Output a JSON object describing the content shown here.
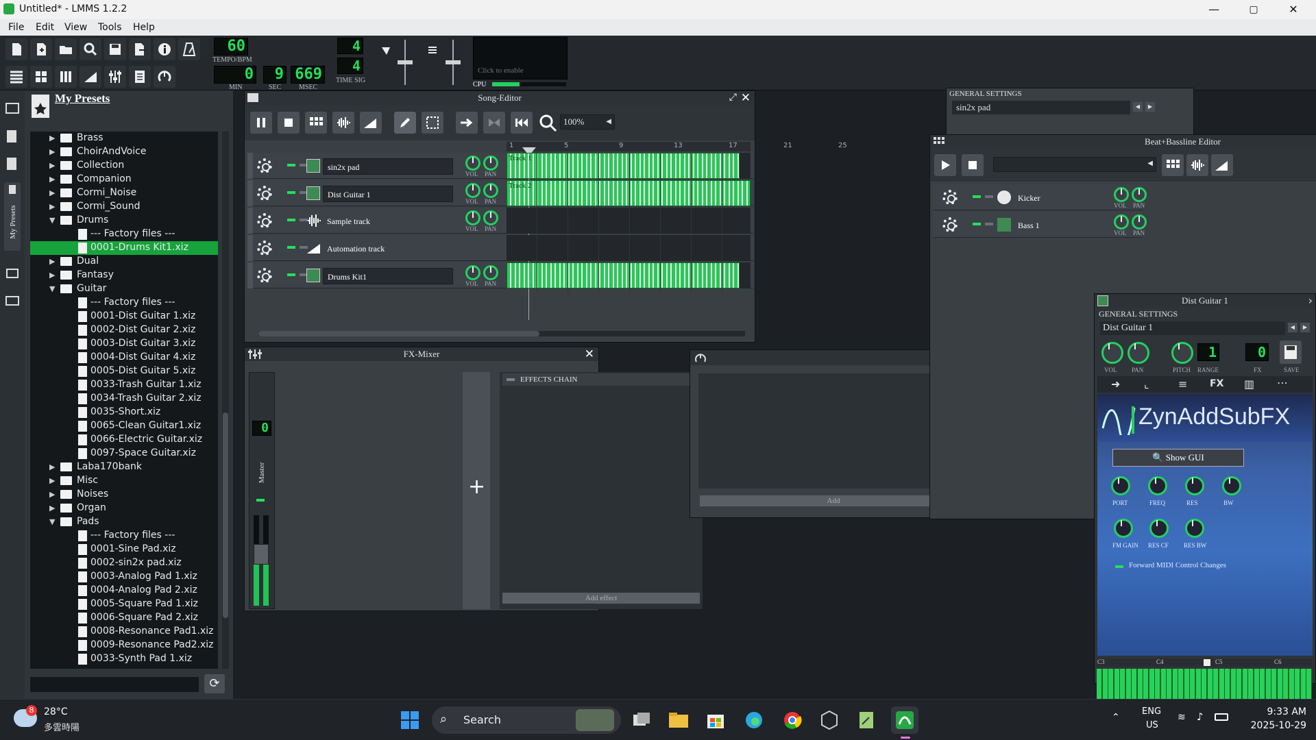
{
  "window": {
    "title": "Untitled* - LMMS 1.2.2",
    "min": "—",
    "max": "▢",
    "close": "✕"
  },
  "menu": [
    "File",
    "Edit",
    "View",
    "Tools",
    "Help"
  ],
  "toolbar": {
    "tempo": "60",
    "tempo_label": "TEMPO/BPM",
    "min": "0",
    "sec": "9",
    "msec": "669",
    "min_label": "MIN",
    "sec_label": "SEC",
    "msec_label": "MSEC",
    "ts_num": "4",
    "ts_den": "4",
    "ts_label": "TIME SIG",
    "cpu_label": "CPU",
    "cpu_hint": "Click to enable"
  },
  "presets": {
    "title": "My Presets",
    "side_tab": "My Presets",
    "items": [
      {
        "label": "Brass",
        "type": "folder",
        "level": 1,
        "open": false
      },
      {
        "label": "ChoirAndVoice",
        "type": "folder",
        "level": 1,
        "open": false
      },
      {
        "label": "Collection",
        "type": "folder",
        "level": 1,
        "open": false
      },
      {
        "label": "Companion",
        "type": "folder",
        "level": 1,
        "open": false
      },
      {
        "label": "Cormi_Noise",
        "type": "folder",
        "level": 1,
        "open": false
      },
      {
        "label": "Cormi_Sound",
        "type": "folder",
        "level": 1,
        "open": false
      },
      {
        "label": "Drums",
        "type": "folder",
        "level": 1,
        "open": true
      },
      {
        "label": "--- Factory files ---",
        "type": "file",
        "level": 2
      },
      {
        "label": "0001-Drums Kit1.xiz",
        "type": "file",
        "level": 2,
        "selected": true
      },
      {
        "label": "Dual",
        "type": "folder",
        "level": 1,
        "open": false
      },
      {
        "label": "Fantasy",
        "type": "folder",
        "level": 1,
        "open": false
      },
      {
        "label": "Guitar",
        "type": "folder",
        "level": 1,
        "open": true
      },
      {
        "label": "--- Factory files ---",
        "type": "file",
        "level": 2
      },
      {
        "label": "0001-Dist Guitar 1.xiz",
        "type": "file",
        "level": 2
      },
      {
        "label": "0002-Dist Guitar 2.xiz",
        "type": "file",
        "level": 2
      },
      {
        "label": "0003-Dist Guitar 3.xiz",
        "type": "file",
        "level": 2
      },
      {
        "label": "0004-Dist Guitar 4.xiz",
        "type": "file",
        "level": 2
      },
      {
        "label": "0005-Dist Guitar 5.xiz",
        "type": "file",
        "level": 2
      },
      {
        "label": "0033-Trash Guitar 1.xiz",
        "type": "file",
        "level": 2
      },
      {
        "label": "0034-Trash Guitar 2.xiz",
        "type": "file",
        "level": 2
      },
      {
        "label": "0035-Short.xiz",
        "type": "file",
        "level": 2
      },
      {
        "label": "0065-Clean Guitar1.xiz",
        "type": "file",
        "level": 2
      },
      {
        "label": "0066-Electric Guitar.xiz",
        "type": "file",
        "level": 2
      },
      {
        "label": "0097-Space Guitar.xiz",
        "type": "file",
        "level": 2
      },
      {
        "label": "Laba170bank",
        "type": "folder",
        "level": 1,
        "open": false
      },
      {
        "label": "Misc",
        "type": "folder",
        "level": 1,
        "open": false
      },
      {
        "label": "Noises",
        "type": "folder",
        "level": 1,
        "open": false
      },
      {
        "label": "Organ",
        "type": "folder",
        "level": 1,
        "open": false
      },
      {
        "label": "Pads",
        "type": "folder",
        "level": 1,
        "open": true
      },
      {
        "label": "--- Factory files ---",
        "type": "file",
        "level": 2
      },
      {
        "label": "0001-Sine Pad.xiz",
        "type": "file",
        "level": 2
      },
      {
        "label": "0002-sin2x  pad.xiz",
        "type": "file",
        "level": 2
      },
      {
        "label": "0003-Analog Pad 1.xiz",
        "type": "file",
        "level": 2
      },
      {
        "label": "0004-Analog Pad 2.xiz",
        "type": "file",
        "level": 2
      },
      {
        "label": "0005-Square Pad 1.xiz",
        "type": "file",
        "level": 2
      },
      {
        "label": "0006-Square Pad 2.xiz",
        "type": "file",
        "level": 2
      },
      {
        "label": "0008-Resonance Pad1.xiz",
        "type": "file",
        "level": 2
      },
      {
        "label": "0009-Resonance Pad2.xiz",
        "type": "file",
        "level": 2
      },
      {
        "label": "0033-Synth Pad 1.xiz",
        "type": "file",
        "level": 2
      }
    ]
  },
  "song_editor": {
    "title": "Song-Editor",
    "zoom": "100%",
    "bars": [
      "1",
      "5",
      "9",
      "13",
      "17",
      "21",
      "25"
    ],
    "tracks": [
      {
        "name": "sin2x  pad",
        "kind": "instrument",
        "clip": "Track 1",
        "clip_len": 0.85
      },
      {
        "name": "Dist Guitar 1",
        "kind": "instrument",
        "clip": "Track 2",
        "clip_len": 0.89
      },
      {
        "name": "Sample track",
        "kind": "sample",
        "clip": "",
        "clip_len": 0
      },
      {
        "name": "Automation track",
        "kind": "automation",
        "clip": "",
        "clip_len": 0
      },
      {
        "name": "Drums Kit1",
        "kind": "instrument",
        "clip": "",
        "clip_len": 0.85
      }
    ],
    "vol": "VOL",
    "pan": "PAN"
  },
  "fx_mixer": {
    "title": "FX-Mixer",
    "master": "Master",
    "master_value": "0",
    "effects_chain": "EFFECTS CHAIN",
    "add_effect": "Add effect"
  },
  "automation": {
    "add": "Add"
  },
  "general_settings": {
    "label": "GENERAL SETTINGS",
    "name": "sin2x  pad"
  },
  "bb_editor": {
    "title": "Beat+Bassline Editor",
    "tracks": [
      {
        "name": "Kicker"
      },
      {
        "name": "Bass 1"
      }
    ]
  },
  "instrument": {
    "title": "Dist Guitar 1",
    "general": "GENERAL SETTINGS",
    "name": "Dist Guitar 1",
    "range": "1",
    "fx": "0",
    "labels": {
      "vol": "VOL",
      "pan": "PAN",
      "pitch": "PITCH",
      "range": "RANGE",
      "fx": "FX",
      "save": "SAVE"
    },
    "tabs": [
      "FX"
    ],
    "plugin": "ZynAddSubFX",
    "show_gui": "Show GUI",
    "knobs1": [
      "PORT",
      "FREQ",
      "RES",
      "BW"
    ],
    "knobs2": [
      "FM GAIN",
      "RES CF",
      "RES BW"
    ],
    "midi": "Forward MIDI Control Changes",
    "octaves": [
      "C3",
      "C4",
      "C5",
      "C6"
    ]
  },
  "taskbar": {
    "temp": "28°C",
    "weather": "多雲時陽",
    "badge": "8",
    "search": "Search",
    "lang1": "ENG",
    "lang2": "US",
    "time": "9:33 AM",
    "date": "2025-10-29"
  }
}
